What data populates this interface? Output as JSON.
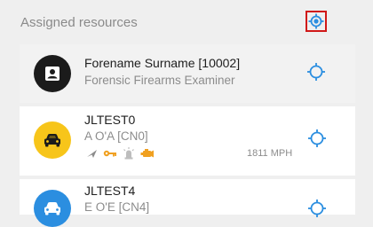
{
  "header": {
    "title": "Assigned resources",
    "locate_all_icon": "crosshair-target-icon"
  },
  "colors": {
    "accent": "#2b8ee0",
    "highlight_border": "#d01818",
    "vehicle_yellow": "#f7c51a",
    "status_orange": "#f0a020"
  },
  "resources": [
    {
      "name": "Forename Surname [10002]",
      "subtitle": "Forensic Firearms Examiner",
      "avatar_icon": "person-icon",
      "selected": true
    },
    {
      "name": "JLTEST0",
      "subtitle": "A O'A [CN0]",
      "avatar_icon": "car-icon",
      "speed": "1811 MPH",
      "status_icons": [
        "heading-arrow-icon",
        "key-icon",
        "siren-icon",
        "engine-icon"
      ]
    },
    {
      "name": "JLTEST4",
      "subtitle": "E O'E [CN4]",
      "avatar_icon": "car-icon"
    }
  ]
}
